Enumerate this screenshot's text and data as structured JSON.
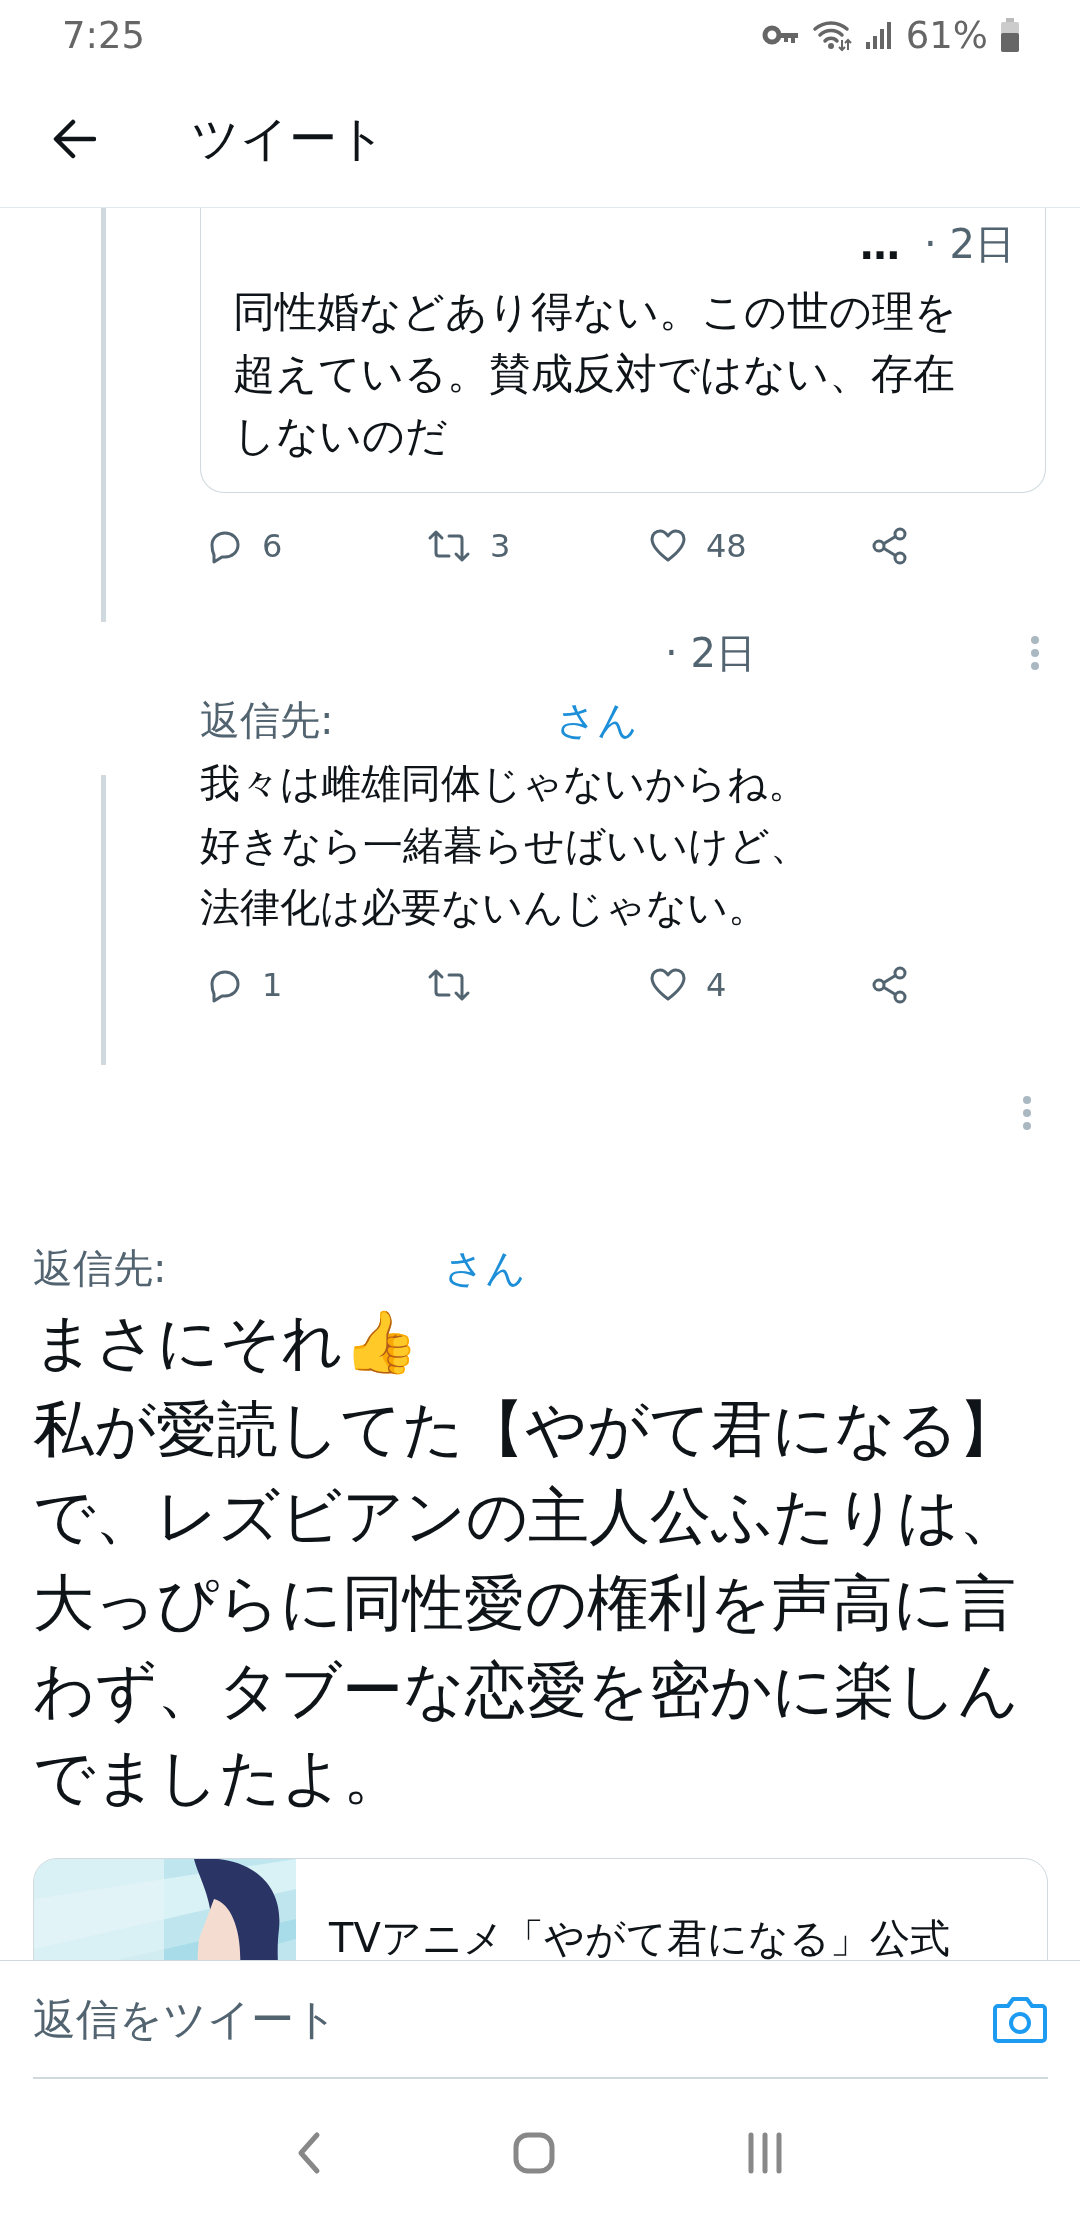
{
  "status_bar": {
    "time": "7:25",
    "battery": "61%"
  },
  "header": {
    "title": "ツイート"
  },
  "thread": [
    {
      "kind": "quoted",
      "name": "…",
      "time": "· 2日",
      "text": "同性婚などあり得ない。この世の理を超えている。賛成反対ではない、存在しないのだ",
      "actions": [
        {
          "kind": "reply",
          "count": "6"
        },
        {
          "kind": "retweet",
          "count": "3"
        },
        {
          "kind": "like",
          "count": "48"
        },
        {
          "kind": "share"
        }
      ]
    },
    {
      "kind": "reply",
      "time": "· 2日",
      "reply_to": {
        "label": "返信先:",
        "suffix": "さん"
      },
      "lines": [
        "我々は雌雄同体じゃないからね。",
        "好きなら一緒暮らせばいいけど、",
        "法律化は必要ないんじゃない。"
      ],
      "actions": [
        {
          "kind": "reply",
          "count": "1"
        },
        {
          "kind": "retweet"
        },
        {
          "kind": "like",
          "count": "4"
        },
        {
          "kind": "share"
        }
      ]
    }
  ],
  "focused_tweet": {
    "reply_to": {
      "label": "返信先:",
      "suffix": "さん"
    },
    "lines": [
      "まさにそれ👍",
      "私が愛読してた【やがて君になる】",
      "で、レズビアンの主人公ふたりは、",
      "大っぴらに同性愛の権利を声高に言",
      "わず、タブーな恋愛を密かに楽しん",
      "でましたよ。"
    ],
    "link_card": {
      "kind": "picture",
      "title": "TVアニメ「やがて君になる」公式"
    }
  },
  "composer": {
    "placeholder": "返信をツイート"
  }
}
